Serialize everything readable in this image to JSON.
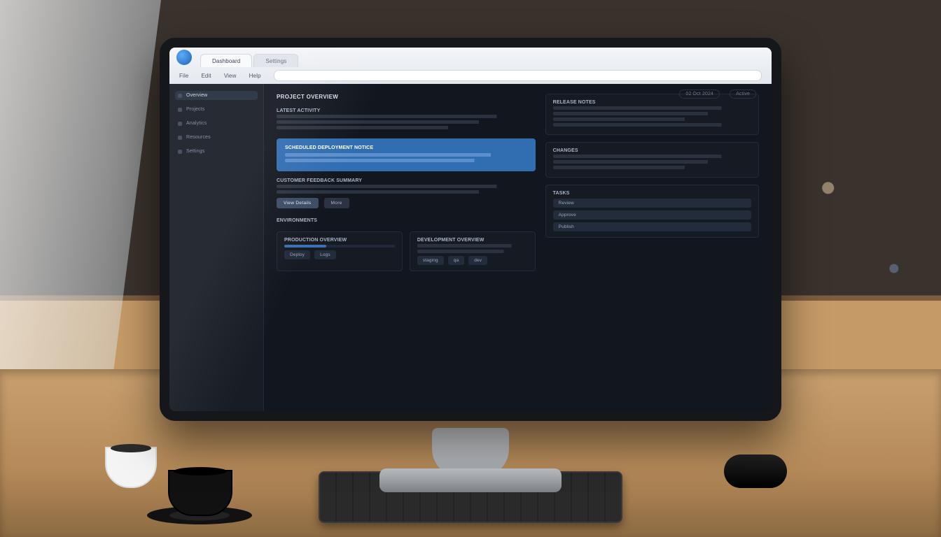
{
  "browser": {
    "tabs": [
      "Dashboard",
      "Settings"
    ],
    "menu": [
      "File",
      "Edit",
      "View",
      "Help"
    ]
  },
  "sidebar": {
    "items": [
      {
        "label": "Overview"
      },
      {
        "label": "Projects"
      },
      {
        "label": "Analytics"
      },
      {
        "label": "Resources"
      },
      {
        "label": "Settings"
      }
    ]
  },
  "header": {
    "title": "Project Overview",
    "meta_date": "02 Oct 2024",
    "meta_status": "Active"
  },
  "main": {
    "intro_heading": "Latest Activity",
    "callout_heading": "Scheduled Deployment Notice",
    "section2_heading": "Customer Feedback Summary",
    "button_view": "View Details",
    "button_more": "More",
    "cards_heading": "Environments",
    "card1_title": "Production Overview",
    "card1_btn1": "Deploy",
    "card1_btn2": "Logs",
    "card2_title": "Development Overview",
    "card2_chips": [
      "staging",
      "qa",
      "dev"
    ]
  },
  "right": {
    "panel1_title": "Release Notes",
    "panel2_title": "Changes",
    "panel3_title": "Tasks",
    "panel3_items": [
      "Review",
      "Approve",
      "Publish"
    ]
  },
  "colors": {
    "accent": "#2e6db5"
  }
}
